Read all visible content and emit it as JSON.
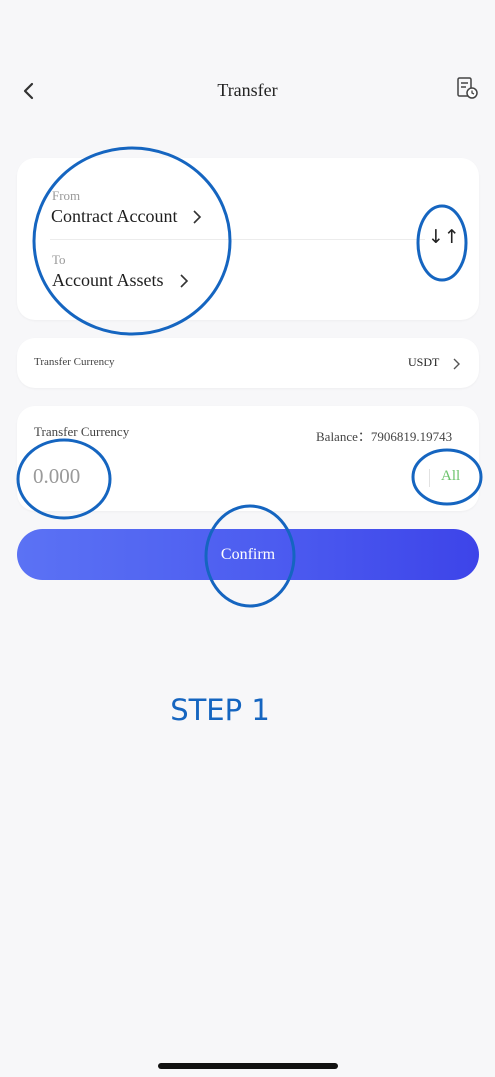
{
  "header": {
    "title": "Transfer",
    "back_icon": "chevron-left-icon",
    "record_icon": "record-document-icon"
  },
  "transfer": {
    "from_label": "From",
    "from_value": "Contract Account",
    "to_label": "To",
    "to_value": "Account Assets",
    "swap_icon": "swap-arrows-icon",
    "swap_glyph": "↓↑"
  },
  "currency": {
    "label": "Transfer Currency",
    "value": "USDT"
  },
  "amount": {
    "label": "Transfer Currency",
    "balance": "Balance：7906819.19743",
    "placeholder": "0.000",
    "all_label": "All"
  },
  "confirm_label": "Confirm",
  "step_label": "STEP 1",
  "colors": {
    "accent": "#4c5cf0",
    "annotation": "#1565c0",
    "all_green": "#6cc36c"
  }
}
